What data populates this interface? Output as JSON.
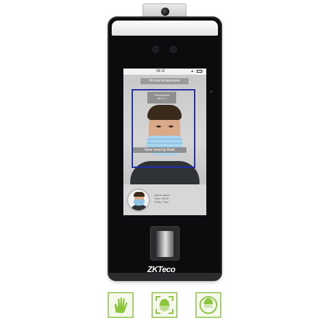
{
  "device": {
    "brand": "ZKTeco",
    "screen": {
      "status_time": "08:15",
      "banner": "Normal temperature",
      "temperature_box": {
        "line1": "Temperature",
        "line2": "36.5 °C"
      },
      "mask_status": "Wear wearing Mask",
      "info": {
        "line1": "Name:Jason",
        "line2": "Time: 08:15",
        "line3": "Verify: Face"
      }
    }
  },
  "features": [
    {
      "name": "palm",
      "icon": "palm-icon"
    },
    {
      "name": "face",
      "icon": "face-icon"
    },
    {
      "name": "mask",
      "icon": "mask-icon"
    }
  ],
  "colors": {
    "frame": "#1f2ea8",
    "feature_border": "#a6cf6f",
    "feature_icon": "#8cc63f",
    "body": "#0c0c0e"
  }
}
